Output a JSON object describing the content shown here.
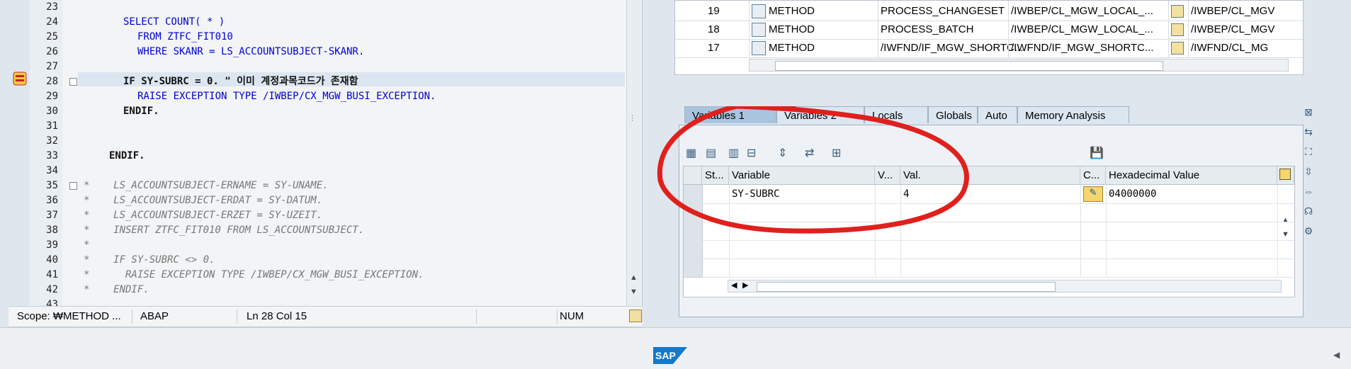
{
  "editor": {
    "lines": [
      {
        "no": "23",
        "text": ""
      },
      {
        "no": "24",
        "text": "SELECT COUNT( * )"
      },
      {
        "no": "25",
        "text": "FROM ZTFC_FIT010"
      },
      {
        "no": "26",
        "text": "WHERE SKANR = LS_ACCOUNTSUBJECT-SKANR."
      },
      {
        "no": "27",
        "text": ""
      },
      {
        "no": "28",
        "text": "IF SY-SUBRC = 0. \" 이미 계정과목코드가 존재함"
      },
      {
        "no": "29",
        "text": "RAISE EXCEPTION TYPE /IWBEP/CX_MGW_BUSI_EXCEPTION."
      },
      {
        "no": "30",
        "text": "ENDIF."
      },
      {
        "no": "31",
        "text": ""
      },
      {
        "no": "32",
        "text": ""
      },
      {
        "no": "33",
        "text": "ENDIF."
      },
      {
        "no": "34",
        "text": ""
      },
      {
        "no": "35",
        "text": "*    LS_ACCOUNTSUBJECT-ERNAME = SY-UNAME."
      },
      {
        "no": "36",
        "text": "*    LS_ACCOUNTSUBJECT-ERDAT = SY-DATUM."
      },
      {
        "no": "37",
        "text": "*    LS_ACCOUNTSUBJECT-ERZET = SY-UZEIT."
      },
      {
        "no": "38",
        "text": "*    INSERT ZTFC_FIT010 FROM LS_ACCOUNTSUBJECT."
      },
      {
        "no": "39",
        "text": "*"
      },
      {
        "no": "40",
        "text": "*    IF SY-SUBRC <> 0."
      },
      {
        "no": "41",
        "text": "*      RAISE EXCEPTION TYPE /IWBEP/CX_MGW_BUSI_EXCEPTION."
      },
      {
        "no": "42",
        "text": "*    ENDIF."
      },
      {
        "no": "43",
        "text": ""
      }
    ],
    "status": {
      "scope": "Scope: ₩METHOD ...",
      "language": "ABAP",
      "position": "Ln  28 Col  15",
      "mode": "NUM"
    }
  },
  "stack": {
    "rows": [
      {
        "no": "19",
        "type": "METHOD",
        "event": "PROCESS_CHANGESET",
        "program": "/IWBEP/CL_MGW_LOCAL_...",
        "include": "/IWBEP/CL_MGV"
      },
      {
        "no": "18",
        "type": "METHOD",
        "event": "PROCESS_BATCH",
        "program": "/IWBEP/CL_MGW_LOCAL_...",
        "include": "/IWBEP/CL_MGV"
      },
      {
        "no": "17",
        "type": "METHOD",
        "event": "/IWFND/IF_MGW_SHORTC...",
        "program": "/IWFND/IF_MGW_SHORTC...",
        "include": "/IWFND/CL_MG"
      }
    ]
  },
  "tabs": [
    "Variables 1",
    "Variables 2",
    "Locals",
    "Globals",
    "Auto",
    "Memory Analysis"
  ],
  "grid": {
    "headers": {
      "st": "St...",
      "variable": "Variable",
      "v": "V...",
      "val": "Val.",
      "c": "C...",
      "hex": "Hexadecimal Value"
    },
    "rows": [
      {
        "variable": "SY-SUBRC",
        "val": "4",
        "hex": "04000000"
      }
    ]
  },
  "footer": {
    "logo": "SAP"
  },
  "colors": {
    "annotation": "#e0201c",
    "keyword": "#0000d0",
    "comment": "#777777"
  }
}
